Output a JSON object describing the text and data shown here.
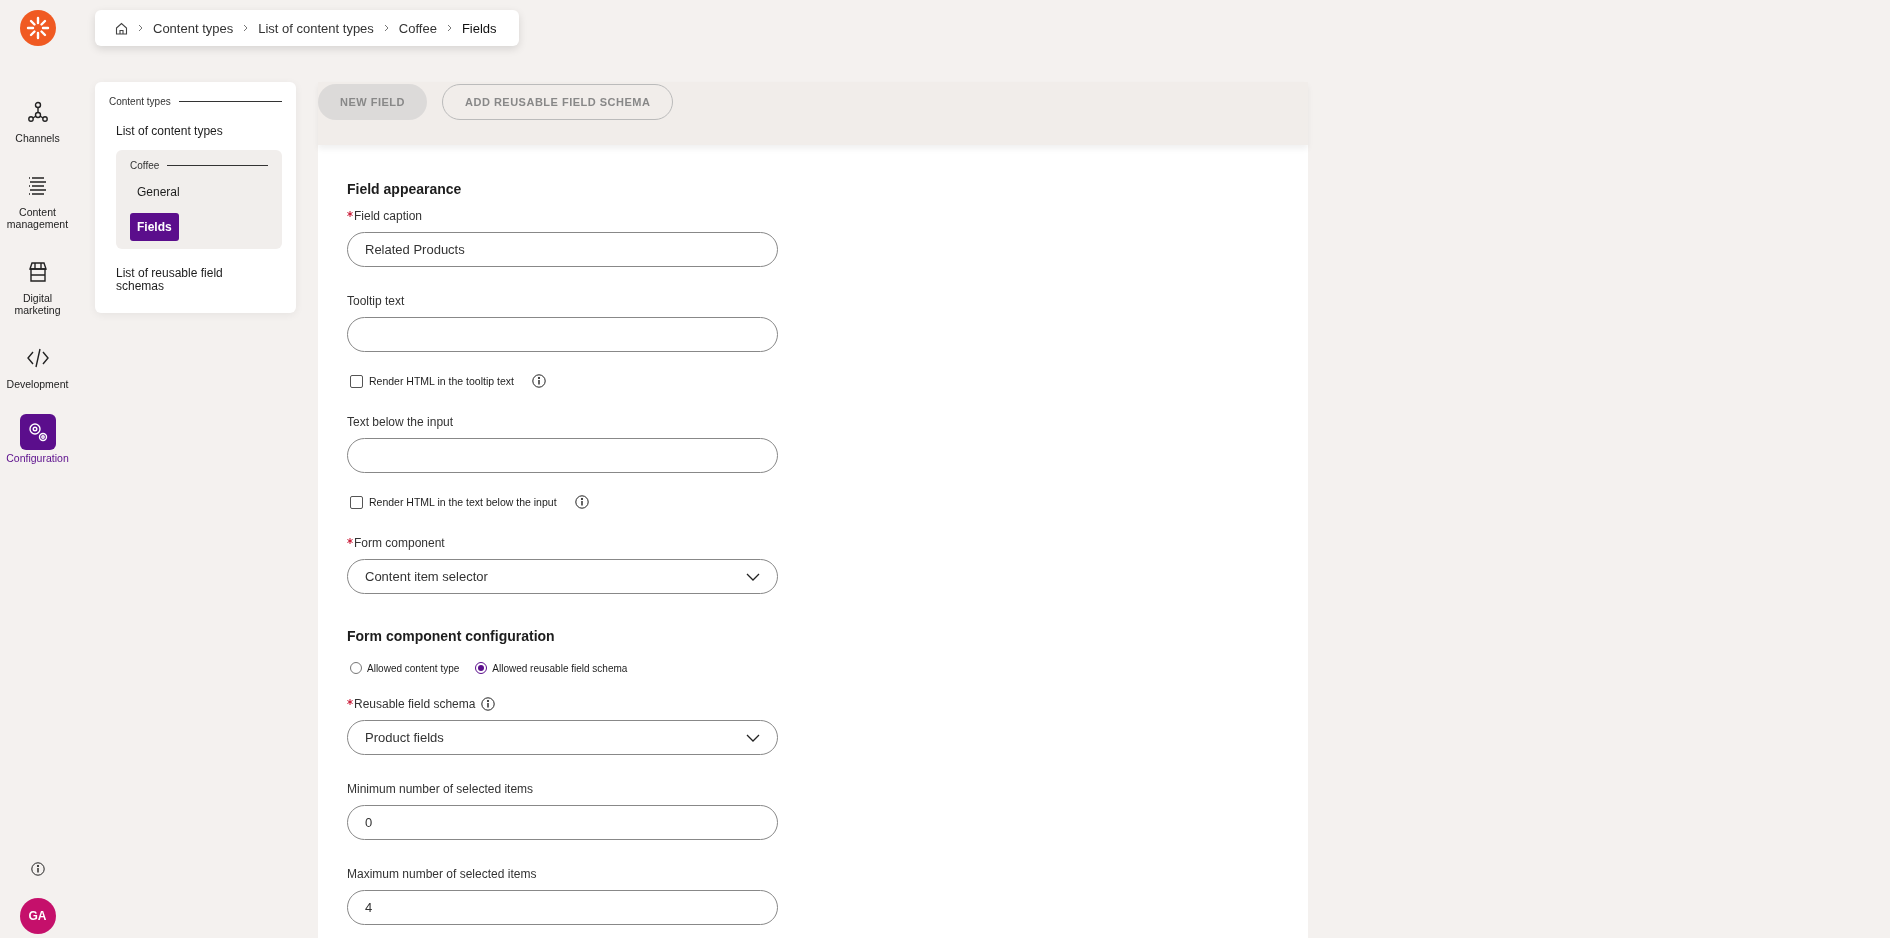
{
  "nav": {
    "items": [
      {
        "label": "Channels",
        "selected": false
      },
      {
        "label": "Content management",
        "selected": false
      },
      {
        "label": "Digital marketing",
        "selected": false
      },
      {
        "label": "Development",
        "selected": false
      },
      {
        "label": "Configuration",
        "selected": true
      }
    ],
    "avatar": "GA"
  },
  "breadcrumb": [
    "Content types",
    "List of content types",
    "Coffee",
    "Fields"
  ],
  "sidebar": {
    "section": "Content types",
    "items": [
      {
        "label": "List of content types",
        "selected": false
      },
      {
        "label": "Coffee",
        "kind": "group",
        "children": [
          {
            "label": "General",
            "selected": false
          },
          {
            "label": "Fields",
            "selected": true
          }
        ]
      },
      {
        "label": "List of reusable field schemas",
        "selected": false
      }
    ]
  },
  "toolbar": [
    {
      "label": "NEW FIELD",
      "kind": "filled"
    },
    {
      "label": "ADD REUSABLE FIELD SCHEMA",
      "kind": "outline"
    }
  ],
  "form": [
    {
      "kind": "heading",
      "text": "Field appearance"
    },
    {
      "kind": "text",
      "label": "Field caption",
      "required": true,
      "value": "Related Products"
    },
    {
      "kind": "text",
      "label": "Tooltip text",
      "required": false
    },
    {
      "kind": "checkbox",
      "label": "Render HTML in the tooltip text",
      "checked": false,
      "info": true
    },
    {
      "kind": "text",
      "label": "Text below the input",
      "required": false
    },
    {
      "kind": "checkbox",
      "label": "Render HTML in the text below the input",
      "checked": false,
      "info": true
    },
    {
      "kind": "select",
      "label": "Form component",
      "required": true,
      "value": "Content item selector",
      "info": false
    },
    {
      "kind": "heading",
      "text": "Form component configuration"
    },
    {
      "kind": "radio",
      "options": [
        {
          "label": "Allowed content type",
          "selected": false
        },
        {
          "label": "Allowed reusable field schema",
          "selected": true
        }
      ]
    },
    {
      "kind": "select",
      "label": "Reusable field schema",
      "required": true,
      "value": "Product fields",
      "info": true
    },
    {
      "kind": "text",
      "label": "Minimum number of selected items",
      "required": false,
      "value": "0"
    },
    {
      "kind": "text",
      "label": "Maximum number of selected items",
      "required": false,
      "value": "4"
    }
  ]
}
